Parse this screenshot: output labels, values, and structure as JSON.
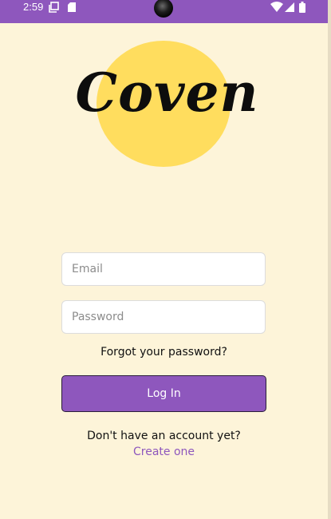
{
  "status_bar": {
    "time": "2:59",
    "icons": [
      "screen-copy-icon",
      "sd-card-icon",
      "wifi-icon",
      "signal-icon",
      "battery-icon"
    ]
  },
  "logo": {
    "text": "Coven"
  },
  "form": {
    "email_placeholder": "Email",
    "password_placeholder": "Password",
    "forgot_label": "Forgot your password?",
    "login_label": "Log In"
  },
  "signup": {
    "prompt": "Don't have an account yet?",
    "link_label": "Create one"
  },
  "colors": {
    "background": "#fdf4d9",
    "accent": "#8e57bd",
    "logo_circle": "#ffdd5e"
  }
}
